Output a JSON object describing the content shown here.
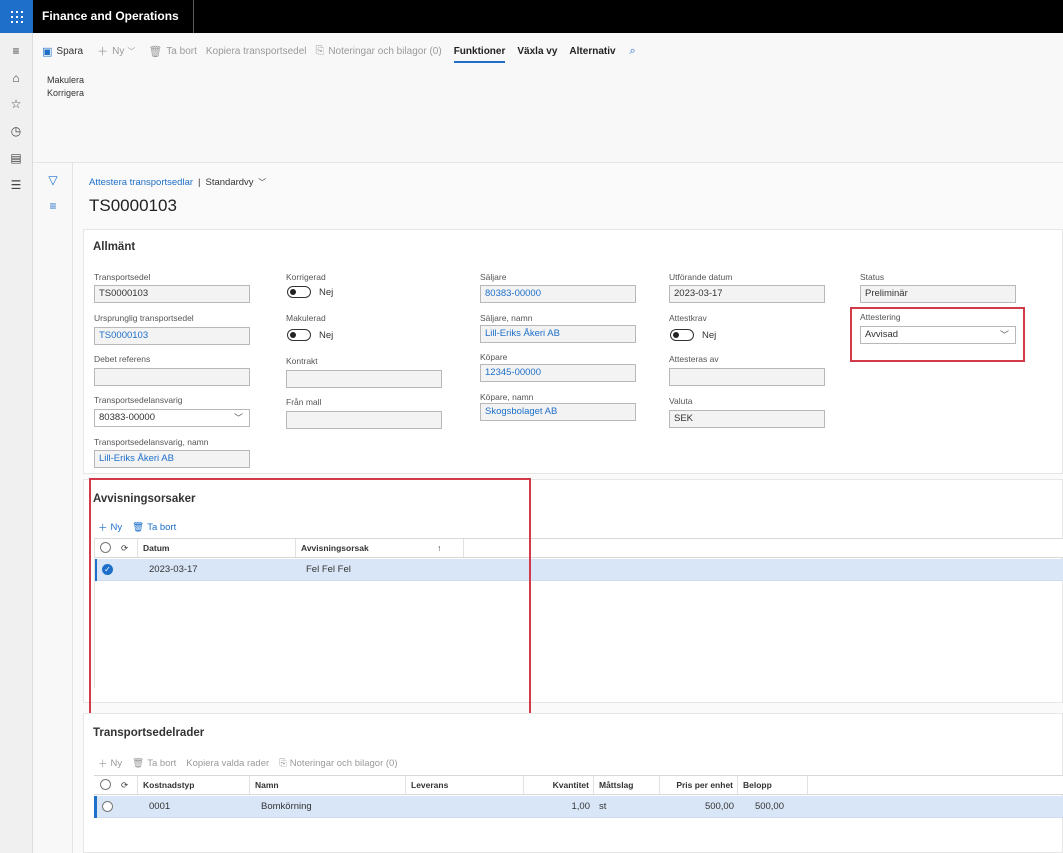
{
  "app": {
    "title": "Finance and Operations"
  },
  "commands": {
    "save": "Spara",
    "new": "Ny",
    "delete": "Ta bort",
    "copy": "Kopiera transportsedel",
    "notes": "Noteringar och bilagor (0)",
    "functions": "Funktioner",
    "switch_view": "Växla vy",
    "options": "Alternativ"
  },
  "sub_actions": [
    "Makulera",
    "Korrigera"
  ],
  "breadcrumb": {
    "page": "Attestera transportsedlar",
    "separator": "|",
    "view": "Standardvy"
  },
  "record_title": "TS0000103",
  "general": {
    "title": "Allmänt",
    "transportsedel_label": "Transportsedel",
    "transportsedel_value": "TS0000103",
    "ursprunglig_label": "Ursprunglig transportsedel",
    "ursprunglig_value": "TS0000103",
    "debet_label": "Debet referens",
    "debet_value": "",
    "ansvarig_label": "Transportsedelansvarig",
    "ansvarig_value": "80383-00000",
    "ansvarig_namn_label": "Transportsedelansvarig, namn",
    "ansvarig_namn_value": "Lill-Eriks Åkeri AB",
    "korrigerad_label": "Korrigerad",
    "korrigerad_value": "Nej",
    "makulerad_label": "Makulerad",
    "makulerad_value": "Nej",
    "kontrakt_label": "Kontrakt",
    "kontrakt_value": "",
    "fran_mall_label": "Från mall",
    "fran_mall_value": "",
    "saljare_label": "Säljare",
    "saljare_value": "80383-00000",
    "saljare_namn_label": "Säljare, namn",
    "saljare_namn_value": "Lill-Eriks Åkeri AB",
    "kopare_label": "Köpare",
    "kopare_value": "12345-00000",
    "kopare_namn_label": "Köpare, namn",
    "kopare_namn_value": "Skogsbolaget AB",
    "utforande_label": "Utförande datum",
    "utforande_value": "2023-03-17",
    "attestkrav_label": "Attestkrav",
    "attestkrav_value": "Nej",
    "attesteras_av_label": "Attesteras av",
    "attesteras_av_value": "",
    "valuta_label": "Valuta",
    "valuta_value": "SEK",
    "status_label": "Status",
    "status_value": "Preliminär",
    "attestering_label": "Attestering",
    "attestering_value": "Avvisad"
  },
  "rejections": {
    "title": "Avvisningsorsaker",
    "new": "Ny",
    "delete": "Ta bort",
    "columns": {
      "date": "Datum",
      "reason": "Avvisningsorsak"
    },
    "rows": [
      {
        "date": "2023-03-17",
        "reason": "Fel Fel Fel"
      }
    ]
  },
  "lines": {
    "title": "Transportsedelrader",
    "new": "Ny",
    "delete": "Ta bort",
    "copy": "Kopiera valda rader",
    "notes": "Noteringar och bilagor (0)",
    "columns": {
      "cost_type": "Kostnadstyp",
      "name": "Namn",
      "delivery": "Leverans",
      "quantity": "Kvantitet",
      "unit": "Måttslag",
      "unit_price": "Pris per enhet",
      "amount": "Belopp"
    },
    "rows": [
      {
        "cost_type": "0001",
        "name": "Bomkörning",
        "delivery": "",
        "quantity": "1,00",
        "unit": "st",
        "unit_price": "500,00",
        "amount": "500,00"
      }
    ]
  }
}
